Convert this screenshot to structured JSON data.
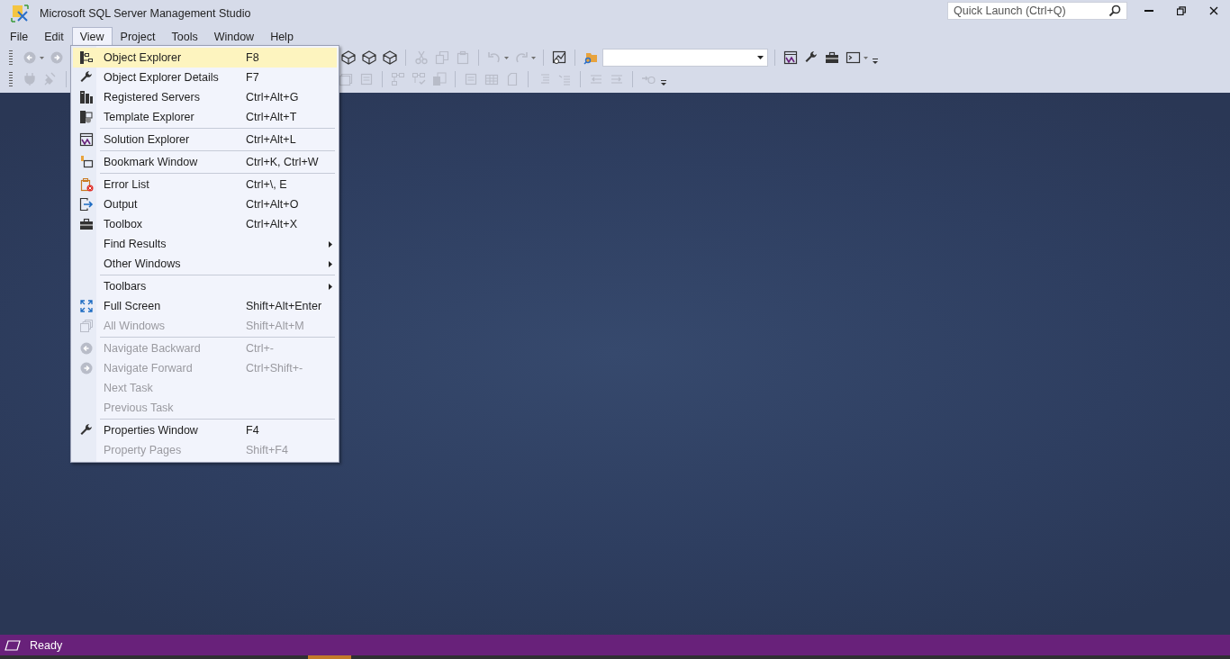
{
  "window": {
    "title": "Microsoft SQL Server Management Studio"
  },
  "quick_launch": {
    "placeholder": "Quick Launch (Ctrl+Q)"
  },
  "menu_bar": [
    {
      "label": "File",
      "selected": false
    },
    {
      "label": "Edit",
      "selected": false
    },
    {
      "label": "View",
      "selected": true
    },
    {
      "label": "Project",
      "selected": false
    },
    {
      "label": "Tools",
      "selected": false
    },
    {
      "label": "Window",
      "selected": false
    },
    {
      "label": "Help",
      "selected": false
    }
  ],
  "view_menu": [
    {
      "kind": "item",
      "label": "Object Explorer",
      "shortcut": "F8",
      "selected": true,
      "disabled": false,
      "submenu": false
    },
    {
      "kind": "item",
      "label": "Object Explorer Details",
      "shortcut": "F7",
      "selected": false,
      "disabled": false,
      "submenu": false
    },
    {
      "kind": "item",
      "label": "Registered Servers",
      "shortcut": "Ctrl+Alt+G",
      "selected": false,
      "disabled": false,
      "submenu": false
    },
    {
      "kind": "item",
      "label": "Template Explorer",
      "shortcut": "Ctrl+Alt+T",
      "selected": false,
      "disabled": false,
      "submenu": false
    },
    {
      "kind": "separator"
    },
    {
      "kind": "item",
      "label": "Solution Explorer",
      "shortcut": "Ctrl+Alt+L",
      "selected": false,
      "disabled": false,
      "submenu": false
    },
    {
      "kind": "separator"
    },
    {
      "kind": "item",
      "label": "Bookmark Window",
      "shortcut": "Ctrl+K, Ctrl+W",
      "selected": false,
      "disabled": false,
      "submenu": false
    },
    {
      "kind": "separator"
    },
    {
      "kind": "item",
      "label": "Error List",
      "shortcut": "Ctrl+\\, E",
      "selected": false,
      "disabled": false,
      "submenu": false
    },
    {
      "kind": "item",
      "label": "Output",
      "shortcut": "Ctrl+Alt+O",
      "selected": false,
      "disabled": false,
      "submenu": false
    },
    {
      "kind": "item",
      "label": "Toolbox",
      "shortcut": "Ctrl+Alt+X",
      "selected": false,
      "disabled": false,
      "submenu": false
    },
    {
      "kind": "item",
      "label": "Find Results",
      "selected": false,
      "disabled": false,
      "submenu": true
    },
    {
      "kind": "item",
      "label": "Other Windows",
      "selected": false,
      "disabled": false,
      "submenu": true
    },
    {
      "kind": "separator"
    },
    {
      "kind": "item",
      "label": "Toolbars",
      "selected": false,
      "disabled": false,
      "submenu": true
    },
    {
      "kind": "item",
      "label": "Full Screen",
      "shortcut": "Shift+Alt+Enter",
      "selected": false,
      "disabled": false,
      "submenu": false
    },
    {
      "kind": "item",
      "label": "All Windows",
      "shortcut": "Shift+Alt+M",
      "selected": false,
      "disabled": true,
      "submenu": false
    },
    {
      "kind": "separator"
    },
    {
      "kind": "item",
      "label": "Navigate Backward",
      "shortcut": "Ctrl+-",
      "selected": false,
      "disabled": true,
      "submenu": false
    },
    {
      "kind": "item",
      "label": "Navigate Forward",
      "shortcut": "Ctrl+Shift+-",
      "selected": false,
      "disabled": true,
      "submenu": false
    },
    {
      "kind": "item",
      "label": "Next Task",
      "selected": false,
      "disabled": true,
      "submenu": false
    },
    {
      "kind": "item",
      "label": "Previous Task",
      "selected": false,
      "disabled": true,
      "submenu": false
    },
    {
      "kind": "separator"
    },
    {
      "kind": "item",
      "label": "Properties Window",
      "shortcut": "F4",
      "selected": false,
      "disabled": false,
      "submenu": false
    },
    {
      "kind": "item",
      "label": "Property Pages",
      "shortcut": "Shift+F4",
      "selected": false,
      "disabled": true,
      "submenu": false
    }
  ],
  "status_bar": {
    "text": "Ready"
  }
}
